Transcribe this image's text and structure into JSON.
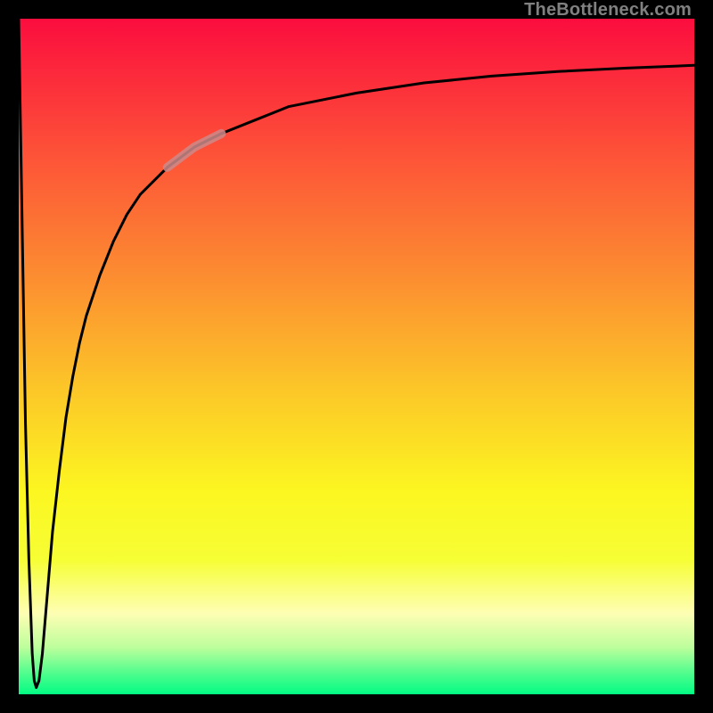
{
  "watermark": "TheBottleneck.com",
  "chart_data": {
    "type": "line",
    "title": "",
    "xlabel": "",
    "ylabel": "",
    "xlim": [
      0,
      100
    ],
    "ylim": [
      0,
      100
    ],
    "grid": false,
    "series": [
      {
        "name": "bottleneck-curve",
        "x": [
          0.0,
          0.5,
          1.0,
          1.5,
          2.0,
          2.3,
          2.6,
          3.0,
          3.5,
          4.0,
          4.5,
          5.0,
          6,
          7,
          8,
          9,
          10,
          12,
          14,
          16,
          18,
          20,
          22,
          26,
          30,
          35,
          40,
          50,
          60,
          70,
          80,
          90,
          100
        ],
        "values": [
          100,
          70,
          40,
          20,
          6,
          2,
          1,
          2,
          6,
          12,
          18,
          24,
          33,
          41,
          47,
          52,
          56,
          62,
          67,
          71,
          74,
          76,
          78,
          81,
          83,
          85,
          87,
          89,
          90.5,
          91.5,
          92.2,
          92.7,
          93.1
        ]
      },
      {
        "name": "highlight-segment",
        "x": [
          22,
          26,
          30
        ],
        "values": [
          78,
          81,
          83
        ]
      }
    ],
    "colors": {
      "curve": "#000000",
      "highlight": "#cc8a8a",
      "gradient_stops": [
        {
          "pos": 0.0,
          "color": "#fb0d3e"
        },
        {
          "pos": 0.2,
          "color": "#fd5238"
        },
        {
          "pos": 0.4,
          "color": "#fc9330"
        },
        {
          "pos": 0.55,
          "color": "#fcc728"
        },
        {
          "pos": 0.7,
          "color": "#fcf621"
        },
        {
          "pos": 0.8,
          "color": "#f6fe34"
        },
        {
          "pos": 0.88,
          "color": "#fefeb4"
        },
        {
          "pos": 0.93,
          "color": "#befe9c"
        },
        {
          "pos": 0.97,
          "color": "#4dfd8d"
        },
        {
          "pos": 1.0,
          "color": "#03fc84"
        }
      ]
    }
  }
}
